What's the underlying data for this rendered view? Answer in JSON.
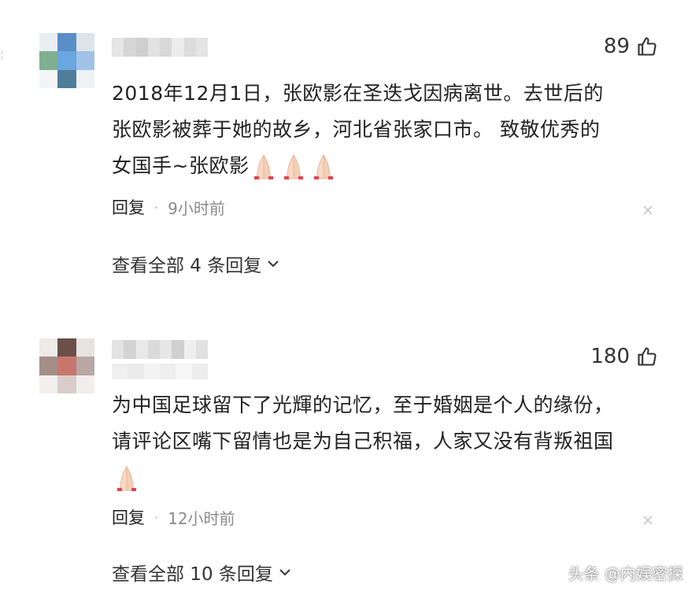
{
  "comments": [
    {
      "likes": "89",
      "text_line1": "2018年12月1日，张欧影在圣迭戈因病离世。去世后的",
      "text_line2": "张欧影被葬于她的故乡，河北省张家口市。 致敬优秀的",
      "text_line3": "女国手~张欧影",
      "reactions": [
        "pray-icon",
        "pray-icon",
        "pray-icon"
      ],
      "reply_label": "回复",
      "separator": "·",
      "time": "9小时前",
      "view_replies": "查看全部 4 条回复"
    },
    {
      "likes": "180",
      "text_line1": "为中国足球留下了光輝的记忆，至于婚姻是个人的缘份，",
      "text_line2": "请评论区嘴下留情也是为自己积福，人家又没有背叛祖国",
      "reactions": [
        "pray-icon"
      ],
      "reply_label": "回复",
      "separator": "·",
      "time": "12小时前",
      "view_replies": "查看全部 10 条回复"
    }
  ],
  "watermark": "头条 @内娱密探",
  "colors": {
    "text": "#222222",
    "meta": "#8a8a8a",
    "background": "#ffffff"
  }
}
